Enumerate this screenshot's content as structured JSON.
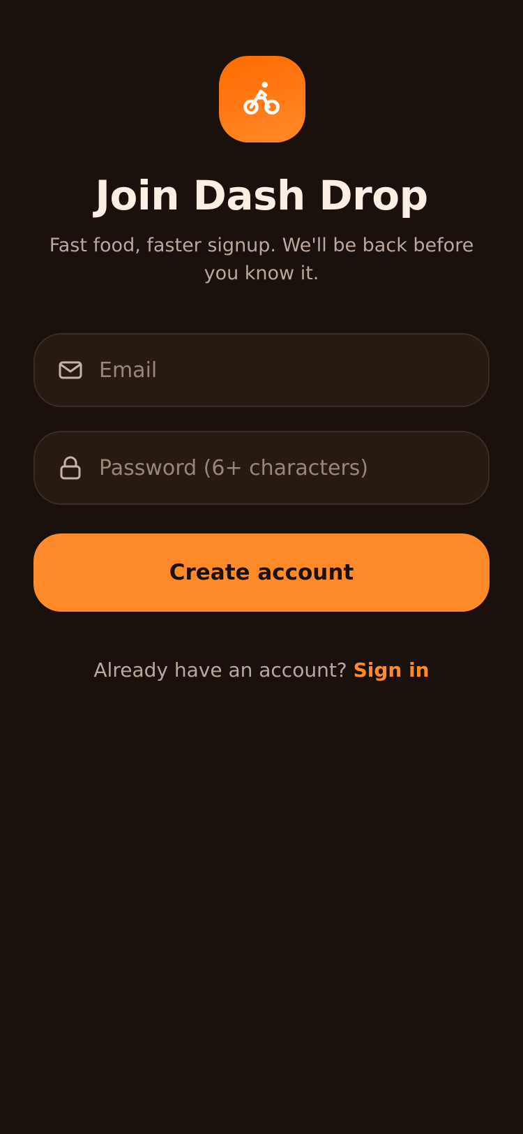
{
  "app": {
    "title": "Join Dash Drop",
    "subtitle": "Fast food, faster signup. We'll be back before you know it."
  },
  "form": {
    "email": {
      "placeholder": "Email",
      "value": "",
      "icon": "mail-icon"
    },
    "password": {
      "placeholder": "Password (6+ characters)",
      "value": "",
      "icon": "lock-icon"
    },
    "submit_label": "Create account"
  },
  "footer": {
    "prompt": "Already have an account?",
    "link_label": "Sign in"
  },
  "logo": {
    "icon": "bike-rider-icon"
  },
  "colors": {
    "background": "#1a110c",
    "accent": "#ff8a2a",
    "accent_deep": "#ff6a00",
    "field_bg": "#261a13",
    "field_border": "#3b2b21",
    "title_text": "#fbeee3",
    "muted_text": "#bca89a"
  }
}
